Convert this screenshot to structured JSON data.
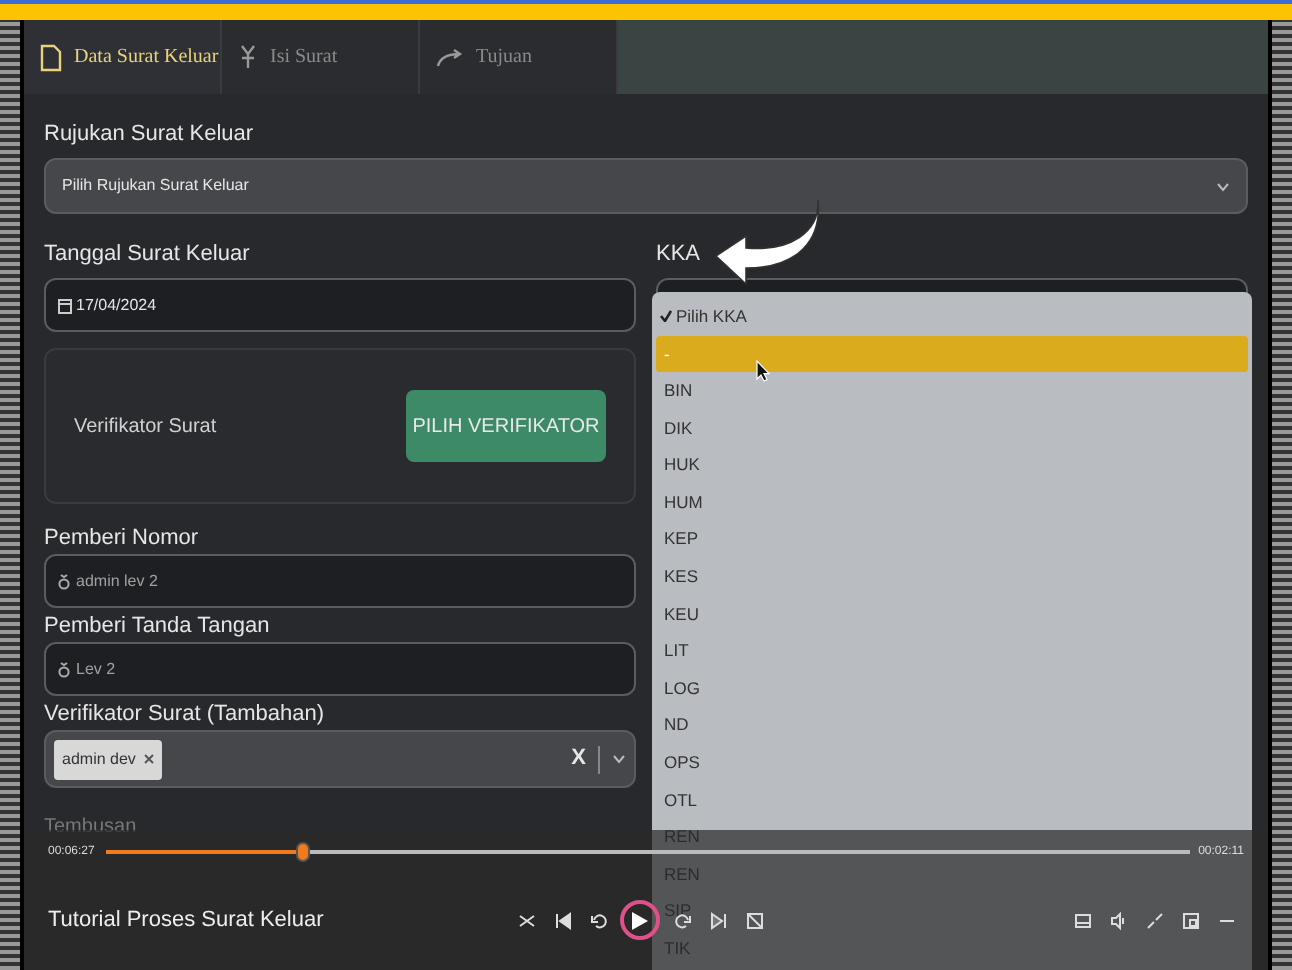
{
  "tabs": [
    {
      "label": "Data Surat Keluar",
      "selected": true
    },
    {
      "label": "Isi Surat",
      "selected": false
    },
    {
      "label": "Tujuan",
      "selected": false
    }
  ],
  "form": {
    "rujukan": {
      "label": "Rujukan Surat Keluar",
      "placeholder": "Pilih Rujukan Surat Keluar"
    },
    "tanggal": {
      "label": "Tanggal Surat Keluar",
      "value": "17/04/2024"
    },
    "verifikator": {
      "label": "Verifikator Surat",
      "button": "PILIH VERIFIKATOR"
    },
    "pemberi_nomor": {
      "label": "Pemberi Nomor",
      "value": "admin lev 2"
    },
    "pemberi_ttd": {
      "label": "Pemberi Tanda Tangan",
      "value": "Lev 2"
    },
    "verifikator_tambahan": {
      "label": "Verifikator Surat (Tambahan)",
      "tags": [
        "admin dev"
      ],
      "clear": "X"
    },
    "tembusan": {
      "label": "Tembusan"
    },
    "kka": {
      "label": "KKA"
    }
  },
  "kka_dropdown": {
    "options": [
      {
        "label": "Pilih KKA",
        "checked": true,
        "highlighted": false
      },
      {
        "label": "-",
        "checked": false,
        "highlighted": true
      },
      {
        "label": "BIN",
        "checked": false,
        "highlighted": false
      },
      {
        "label": "DIK",
        "checked": false,
        "highlighted": false
      },
      {
        "label": "HUK",
        "checked": false,
        "highlighted": false
      },
      {
        "label": "HUM",
        "checked": false,
        "highlighted": false
      },
      {
        "label": "KEP",
        "checked": false,
        "highlighted": false
      },
      {
        "label": "KES",
        "checked": false,
        "highlighted": false
      },
      {
        "label": "KEU",
        "checked": false,
        "highlighted": false
      },
      {
        "label": "LIT",
        "checked": false,
        "highlighted": false
      },
      {
        "label": "LOG",
        "checked": false,
        "highlighted": false
      },
      {
        "label": "ND",
        "checked": false,
        "highlighted": false
      },
      {
        "label": "OPS",
        "checked": false,
        "highlighted": false
      },
      {
        "label": "OTL",
        "checked": false,
        "highlighted": false
      },
      {
        "label": "REN",
        "checked": false,
        "highlighted": false
      },
      {
        "label": "REN",
        "checked": false,
        "highlighted": false
      },
      {
        "label": "SIP",
        "checked": false,
        "highlighted": false
      },
      {
        "label": "TIK",
        "checked": false,
        "highlighted": false
      }
    ]
  },
  "player": {
    "elapsed": "00:06:27",
    "remaining": "00:02:11",
    "level": 0.18,
    "title": "Tutorial Proses Surat Keluar",
    "playing": false
  }
}
